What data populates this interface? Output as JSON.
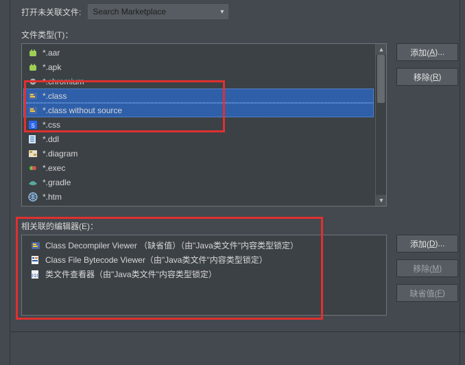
{
  "top": {
    "open_unassoc_label": "打开未关联文件:",
    "combo_value": "Search Marketplace"
  },
  "filetypes_label": "文件类型(T)：",
  "filetypes": [
    {
      "ext": "*.aar",
      "icon": "android",
      "selected": false
    },
    {
      "ext": "*.apk",
      "icon": "android",
      "selected": false
    },
    {
      "ext": "*.chromium",
      "icon": "gear",
      "selected": false
    },
    {
      "ext": "*.class",
      "icon": "class",
      "selected": true
    },
    {
      "ext": "*.class without source",
      "icon": "class",
      "selected": true
    },
    {
      "ext": "*.css",
      "icon": "css",
      "selected": false
    },
    {
      "ext": "*.ddl",
      "icon": "sql",
      "selected": false
    },
    {
      "ext": "*.diagram",
      "icon": "diagram",
      "selected": false
    },
    {
      "ext": "*.exec",
      "icon": "exec",
      "selected": false
    },
    {
      "ext": "*.gradle",
      "icon": "gradle",
      "selected": false
    },
    {
      "ext": "*.htm",
      "icon": "globe",
      "selected": false
    }
  ],
  "ft_buttons": {
    "add": {
      "label": "添加(",
      "mn": "A",
      "tail": ")..."
    },
    "remove": {
      "label": "移除(",
      "mn": "R",
      "tail": ")"
    }
  },
  "editors_label": "相关联的编辑器(E)：",
  "editors": [
    {
      "name": "Class Decompiler Viewer （缺省值）（由\"Java类文件\"内容类型锁定）",
      "icon": "class"
    },
    {
      "name": "Class File Bytecode Viewer（由\"Java类文件\"内容类型锁定）",
      "icon": "bytecode"
    },
    {
      "name": "类文件查看器（由\"Java类文件\"内容类型锁定）",
      "icon": "binary"
    }
  ],
  "ed_buttons": {
    "add": {
      "label": "添加(",
      "mn": "D",
      "tail": ")..."
    },
    "remove": {
      "label": "移除(",
      "mn": "M",
      "tail": ")"
    },
    "default": {
      "label": "缺省值(",
      "mn": "F",
      "tail": ")"
    }
  }
}
